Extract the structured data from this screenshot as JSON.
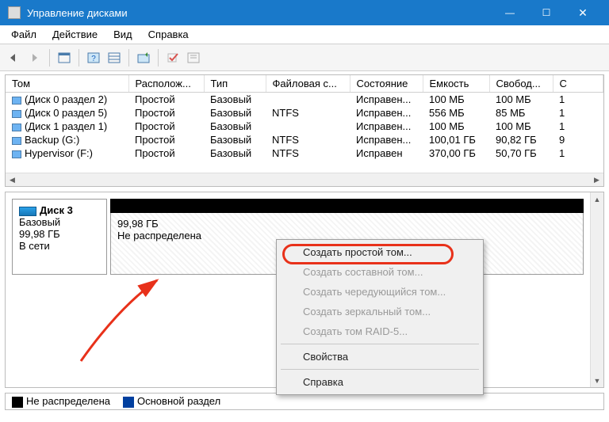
{
  "title": "Управление дисками",
  "winbuttons": {
    "min": "—",
    "max": "☐",
    "close": "✕"
  },
  "menu": [
    "Файл",
    "Действие",
    "Вид",
    "Справка"
  ],
  "columns": [
    "Том",
    "Располож...",
    "Тип",
    "Файловая с...",
    "Состояние",
    "Емкость",
    "Свобод...",
    "С"
  ],
  "rows": [
    {
      "vol": "(Диск 0 раздел 2)",
      "layout": "Простой",
      "type": "Базовый",
      "fs": "",
      "status": "Исправен...",
      "cap": "100 МБ",
      "free": "100 МБ",
      "p": "1"
    },
    {
      "vol": "(Диск 0 раздел 5)",
      "layout": "Простой",
      "type": "Базовый",
      "fs": "NTFS",
      "status": "Исправен...",
      "cap": "556 МБ",
      "free": "85 МБ",
      "p": "1"
    },
    {
      "vol": "(Диск 1 раздел 1)",
      "layout": "Простой",
      "type": "Базовый",
      "fs": "",
      "status": "Исправен...",
      "cap": "100 МБ",
      "free": "100 МБ",
      "p": "1"
    },
    {
      "vol": "Backup (G:)",
      "layout": "Простой",
      "type": "Базовый",
      "fs": "NTFS",
      "status": "Исправен...",
      "cap": "100,01 ГБ",
      "free": "90,82 ГБ",
      "p": "9"
    },
    {
      "vol": "Hypervisor (F:)",
      "layout": "Простой",
      "type": "Базовый",
      "fs": "NTFS",
      "status": "Исправен",
      "cap": "370,00 ГБ",
      "free": "50,70 ГБ",
      "p": "1"
    }
  ],
  "disk": {
    "name": "Диск 3",
    "type": "Базовый",
    "size": "99,98 ГБ",
    "status": "В сети",
    "vol_size": "99,98 ГБ",
    "vol_state": "Не распределена"
  },
  "legend": {
    "unalloc": "Не распределена",
    "primary": "Основной раздел"
  },
  "ctx": {
    "simple": "Создать простой том...",
    "spanned": "Создать составной том...",
    "striped": "Создать чередующийся том...",
    "mirror": "Создать зеркальный том...",
    "raid5": "Создать том RAID-5...",
    "props": "Свойства",
    "help": "Справка"
  }
}
